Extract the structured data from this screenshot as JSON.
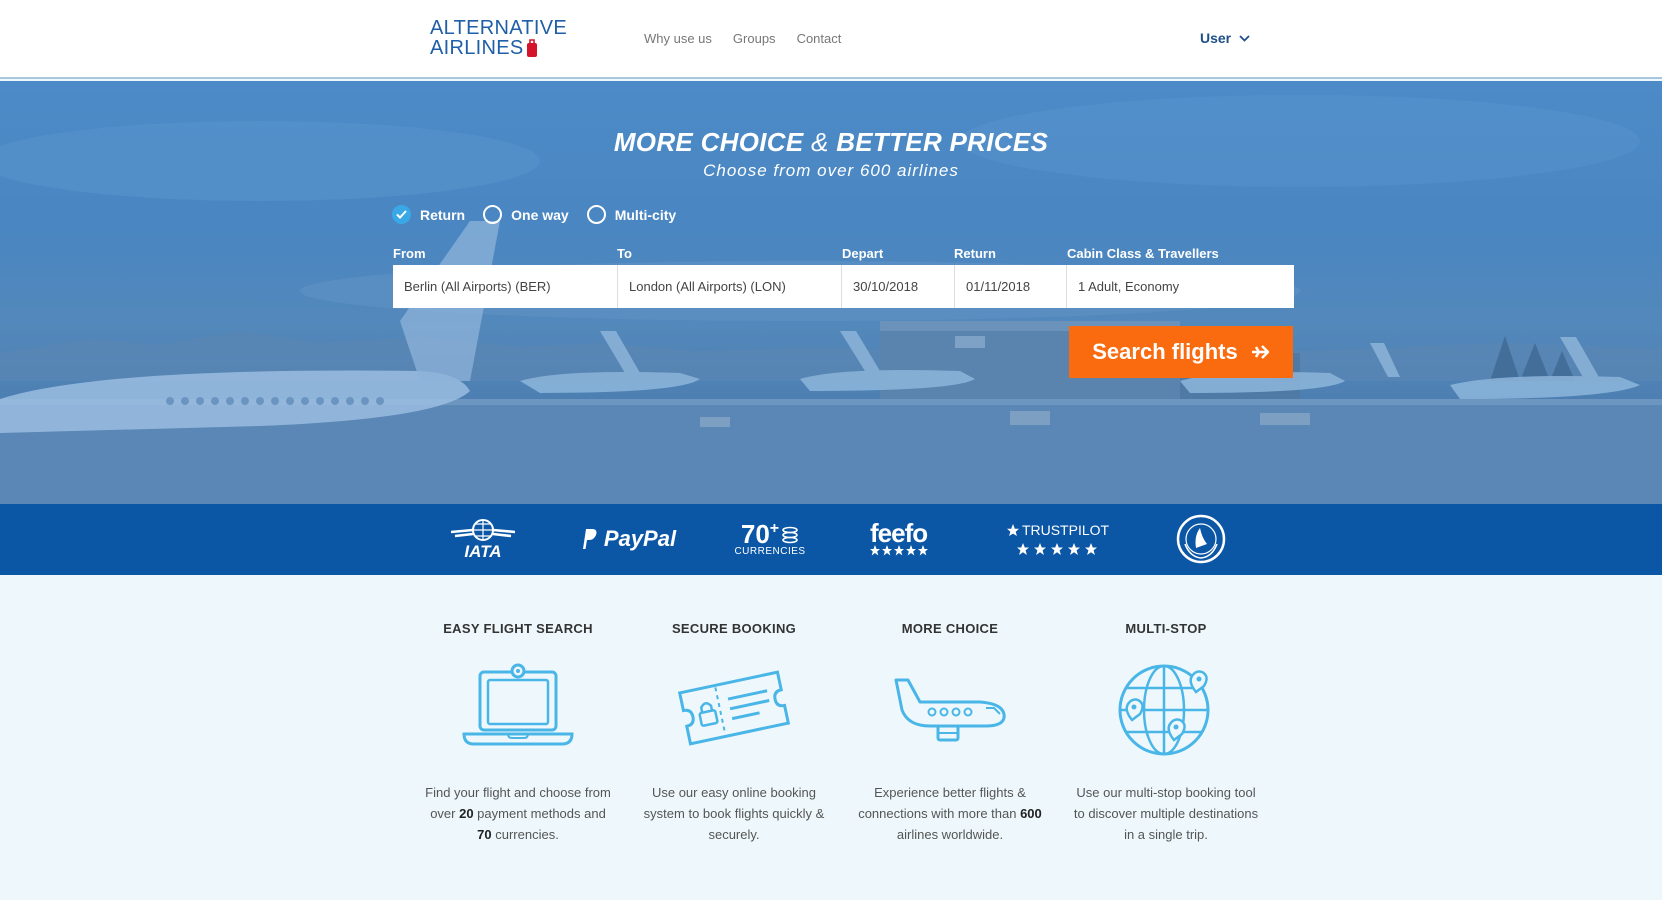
{
  "brand": {
    "logo_line1": "ALTERNATIVE",
    "logo_line2": "AIRLINES",
    "accent_color": "#f96b0e",
    "primary_color": "#0b56a5"
  },
  "nav": {
    "items": [
      {
        "label": "Why use us"
      },
      {
        "label": "Groups"
      },
      {
        "label": "Contact"
      }
    ],
    "user_label": "User"
  },
  "hero": {
    "title_part1": "MORE CHOICE",
    "title_amp": "&",
    "title_part2": "BETTER PRICES",
    "subtitle": "Choose from over 600 airlines"
  },
  "search": {
    "trip_types": [
      {
        "label": "Return",
        "selected": true
      },
      {
        "label": "One way",
        "selected": false
      },
      {
        "label": "Multi-city",
        "selected": false
      }
    ],
    "labels": {
      "from": "From",
      "to": "To",
      "depart": "Depart",
      "return": "Return",
      "cabin": "Cabin Class & Travellers"
    },
    "values": {
      "from": "Berlin (All Airports) (BER)",
      "to": "London (All Airports) (LON)",
      "depart": "30/10/2018",
      "return": "01/11/2018",
      "cabin": "1 Adult, Economy"
    },
    "button_label": "Search flights"
  },
  "trust_bar": {
    "iata": "IATA",
    "paypal": "PayPal",
    "currencies_num": "70",
    "currencies_plus": "+",
    "currencies_label": "CURRENCIES",
    "feefo": "feefo",
    "trustpilot": "TRUSTPILOT",
    "atol": "ATOL PROTECTED"
  },
  "features": [
    {
      "title": "EASY FLIGHT SEARCH",
      "icon": "laptop-icon",
      "text_a": "Find your flight and choose from over ",
      "bold_a": "20",
      "text_b": " payment methods and ",
      "bold_b": "70",
      "text_c": " currencies."
    },
    {
      "title": "SECURE BOOKING",
      "icon": "ticket-lock-icon",
      "text_a": "Use our easy online booking system to book flights quickly & securely."
    },
    {
      "title": "MORE CHOICE",
      "icon": "airplane-icon",
      "text_a": "Experience better flights & connections with more than ",
      "bold_a": "600",
      "text_b": " airlines worldwide."
    },
    {
      "title": "MULTI-STOP",
      "icon": "globe-pins-icon",
      "text_a": "Use our multi-stop booking tool to discover multiple destinations in a single trip."
    }
  ]
}
